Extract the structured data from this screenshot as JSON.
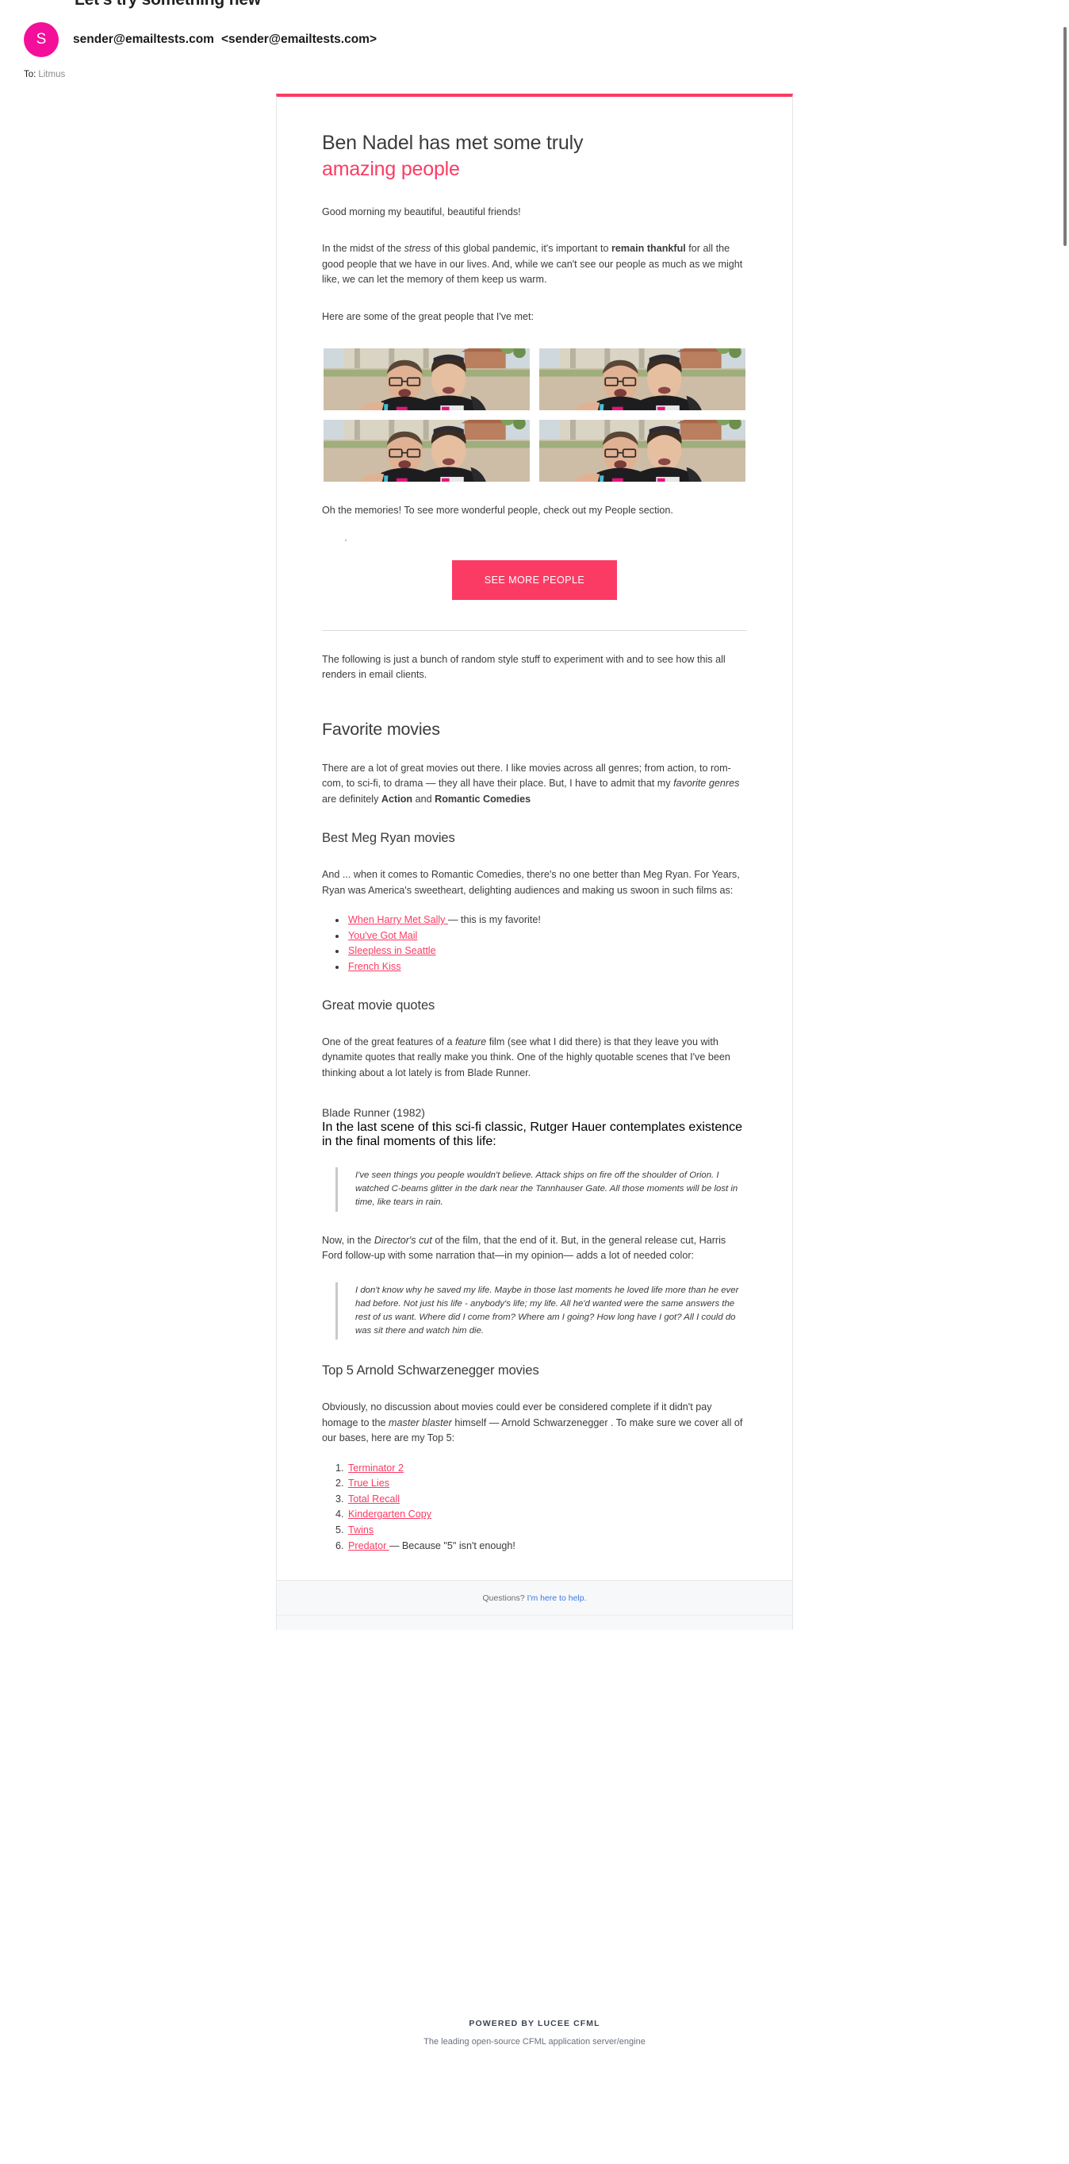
{
  "client": {
    "subject": "Let's try something new",
    "avatar_initial": "S",
    "sender": "sender@emailtests.com",
    "sender_address": "<sender@emailtests.com>",
    "to_label": "To:",
    "to_value": "Litmus",
    "accent_color": "#fb3b64",
    "avatar_color": "#f40f9a",
    "link_color": "#3b79e8"
  },
  "email": {
    "title_line1": "Ben Nadel has met some truly",
    "title_line2": "amazing people",
    "greeting": "Good morning my beautiful, beautiful friends!",
    "intro_a": "In the midst of the ",
    "intro_em": "stress",
    "intro_b": " of this global pandemic, it's important to ",
    "intro_strong": "remain thankful",
    "intro_c": " for all the good people that we have in our lives. And, while we can't see our people as much as we might like, we can let the memory of them keep us warm.",
    "photos_lead": "Here are some of the great people that I've met:",
    "photo_alt": "Two friends posing outdoors at a conference, one pointing at the other's t-shirt",
    "photo_count": 4,
    "memories": "Oh the memories! To see more wonderful people, check out my People section.",
    "dot_marker": "·",
    "cta_label": "SEE MORE PEOPLE",
    "experiment_note": "The following is just a bunch of random style stuff to experiment with and to see how this all renders in email clients."
  },
  "movies": {
    "h2": "Favorite movies",
    "intro_a": "There are a lot of great movies out there. I like movies across all genres; from action, to rom-com, to sci-fi, to drama — they all have their place. But, I have to admit that my ",
    "intro_em": "favorite genres",
    "intro_b": " are definitely ",
    "intro_strong1": "Action",
    "intro_c": " and ",
    "intro_strong2": "Romantic Comedies",
    "meg_h3": "Best Meg Ryan movies",
    "meg_intro": "And ... when it comes to Romantic Comedies, there's no one better than Meg Ryan. For Years, Ryan was America's sweetheart, delighting audiences and making us swoon in such films as:",
    "meg_list": [
      {
        "link": "When Harry Met Sally ",
        "suffix": "— this is my favorite!"
      },
      {
        "link": "You've Got Mail",
        "suffix": ""
      },
      {
        "link": "Sleepless in Seattle",
        "suffix": ""
      },
      {
        "link": "French Kiss",
        "suffix": ""
      }
    ],
    "quotes_h3": "Great movie quotes",
    "quotes_intro_a": "One of the great features of a ",
    "quotes_intro_em": "feature",
    "quotes_intro_b": " film (see what I did there) is that they leave you with dynamite quotes that really make you think. One of the highly quotable scenes that I've been thinking about a lot lately is from Blade Runner.",
    "blade_h4": "Blade Runner (1982)",
    "blade_lead": "In the last scene of this sci-fi classic, Rutger Hauer contemplates existence in the final moments of this life:",
    "blade_quote": "I've seen things you people wouldn't believe. Attack ships on fire off the shoulder of Orion. I watched C-beams glitter in the dark near the Tannhauser Gate. All those moments will be lost in time, like tears in rain.",
    "director_a": "Now, in the ",
    "director_em": "Director's cut",
    "director_b": " of the film, that the end of it. But, in the general release cut, Harris Ford follow-up with some narration that—in my opinion— adds a lot of needed color:",
    "ford_quote": "I don't know why he saved my life. Maybe in those last moments he loved life more than he ever had before. Not just his life - anybody's life; my life. All he'd wanted were the same answers the rest of us want. Where did I come from? Where am I going? How long have I got? All I could do was sit there and watch him die.",
    "arnold_h3": "Top 5 Arnold Schwarzenegger movies",
    "arnold_intro_a": "Obviously, no discussion about movies could ever be considered complete if it didn't pay homage to the ",
    "arnold_intro_em": "master blaster",
    "arnold_intro_b": " himself — Arnold Schwarzenegger . To make sure we cover all of our bases, here are my Top 5:",
    "arnold_list": [
      {
        "link": "Terminator 2",
        "suffix": ""
      },
      {
        "link": "True Lies",
        "suffix": ""
      },
      {
        "link": "Total Recall",
        "suffix": ""
      },
      {
        "link": "Kindergarten Copy",
        "suffix": ""
      },
      {
        "link": "Twins",
        "suffix": ""
      },
      {
        "link": "Predator ",
        "suffix": "— Because \"5\" isn't enough!"
      }
    ]
  },
  "footer": {
    "questions_text": "Questions?",
    "questions_link": "I'm here to help.",
    "brand": "POWERED BY LUCEE CFML",
    "tagline": "The leading open-source CFML application server/engine"
  }
}
